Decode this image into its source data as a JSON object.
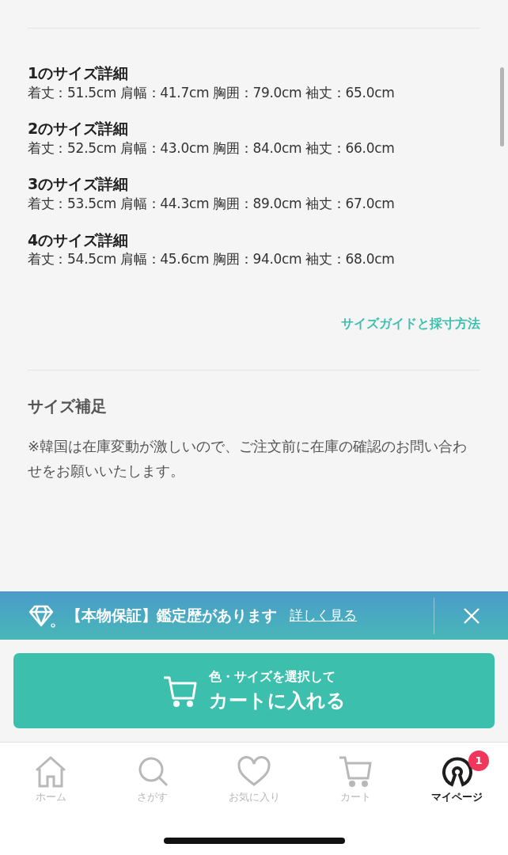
{
  "size_details": [
    {
      "title": "1のサイズ詳細",
      "measurements": "着丈：51.5cm 肩幅：41.7cm 胸囲：79.0cm 袖丈：65.0cm"
    },
    {
      "title": "2のサイズ詳細",
      "measurements": "着丈：52.5cm 肩幅：43.0cm 胸囲：84.0cm 袖丈：66.0cm"
    },
    {
      "title": "3のサイズ詳細",
      "measurements": "着丈：53.5cm 肩幅：44.3cm 胸囲：89.0cm 袖丈：67.0cm"
    },
    {
      "title": "4のサイズ詳細",
      "measurements": "着丈：54.5cm 肩幅：45.6cm 胸囲：94.0cm 袖丈：68.0cm"
    }
  ],
  "size_guide_link": "サイズガイドと採寸方法",
  "supplement": {
    "heading": "サイズ補足",
    "text": "※韓国は在庫変動が激しいので、ご注文前に在庫の確認のお問い合わせをお願いいたします。"
  },
  "banner": {
    "text": "【本物保証】鑑定歴があります",
    "link": "詳しく見る"
  },
  "cart_button": {
    "subtitle": "色・サイズを選択して",
    "label": "カートに入れる"
  },
  "tabs": [
    {
      "kind": "home",
      "label": "ホーム",
      "selected": false
    },
    {
      "kind": "search",
      "label": "さがす",
      "selected": false
    },
    {
      "kind": "heart",
      "label": "お気に入り",
      "selected": false
    },
    {
      "kind": "cart",
      "label": "カート",
      "selected": false
    },
    {
      "kind": "mypage",
      "label": "マイページ",
      "selected": true,
      "badge": "1"
    }
  ]
}
